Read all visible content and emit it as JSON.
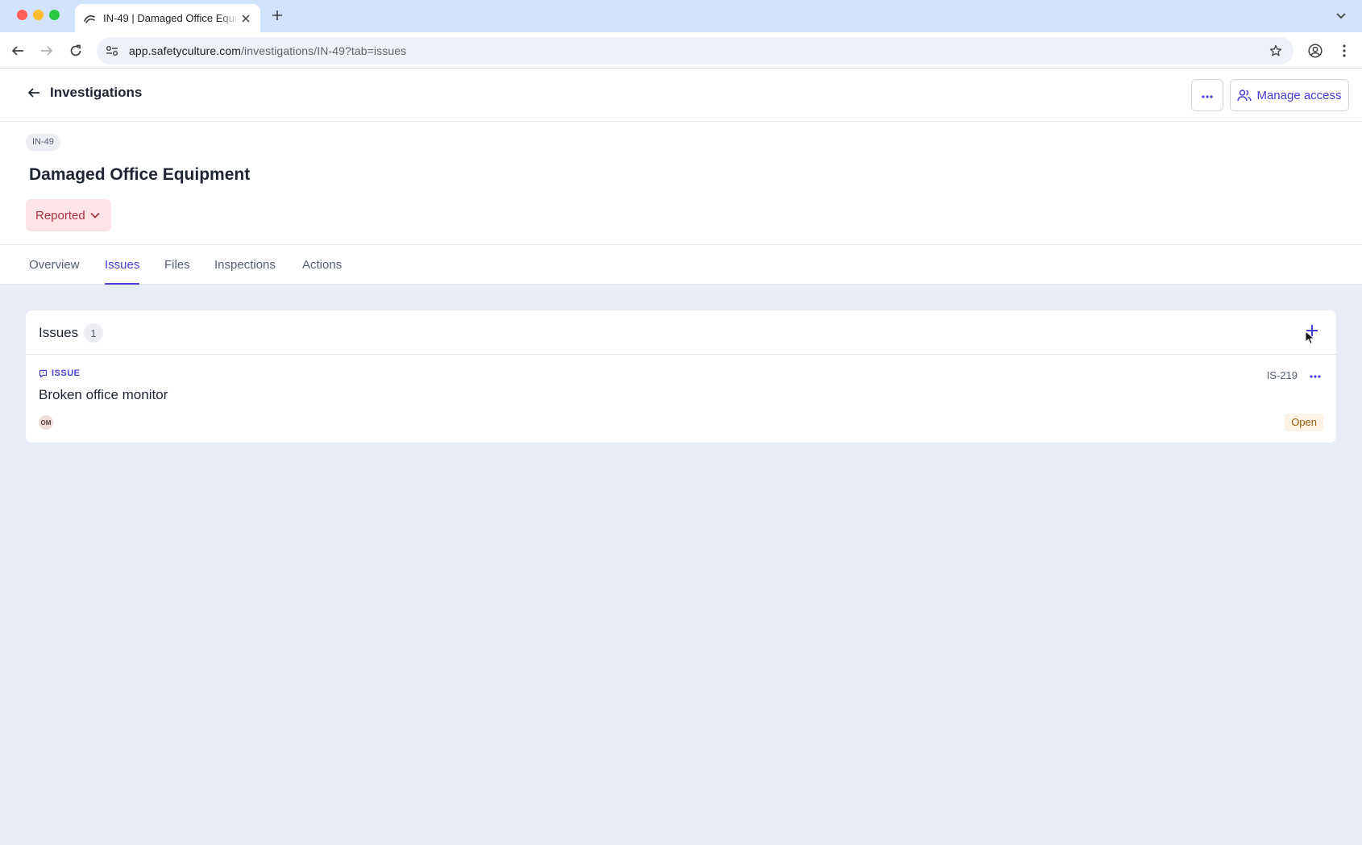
{
  "browser": {
    "tab_title": "IN-49 | Damaged Office Equipment",
    "url_host": "app.safetyculture.com",
    "url_path": "/investigations/IN-49?tab=issues"
  },
  "header": {
    "back_label": "Investigations",
    "manage_access_label": "Manage access"
  },
  "summary": {
    "id": "IN-49",
    "title": "Damaged Office Equipment",
    "status": "Reported"
  },
  "tabs": [
    {
      "label": "Overview"
    },
    {
      "label": "Issues"
    },
    {
      "label": "Files"
    },
    {
      "label": "Inspections"
    },
    {
      "label": "Actions"
    }
  ],
  "active_tab": "Issues",
  "issues_card": {
    "title": "Issues",
    "count": "1",
    "items": [
      {
        "type": "ISSUE",
        "title": "Broken office monitor",
        "id": "IS-219",
        "assignee_initials": "OM",
        "status": "Open"
      }
    ]
  },
  "colors": {
    "accent": "#4740d4",
    "status_reported_bg": "#fde4e6",
    "status_open_bg": "#fdf2e3",
    "page_bg": "#e8ecf6"
  }
}
